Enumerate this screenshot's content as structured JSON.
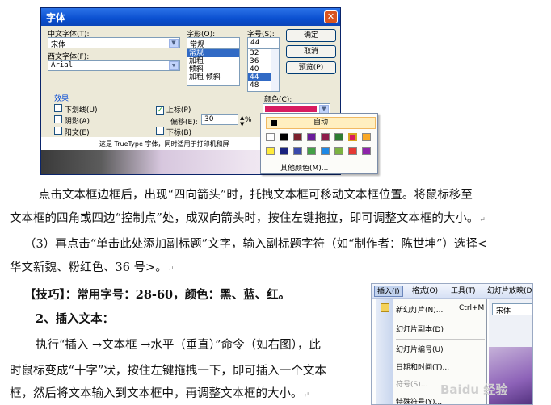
{
  "font_dialog": {
    "title": "字体",
    "close_glyph": "✕",
    "chinese_font_label": "中文字体(T):",
    "chinese_font_value": "宋体",
    "western_font_label": "西文字体(F):",
    "western_font_value": "Arial",
    "style_label": "字形(O):",
    "style_value": "常规",
    "style_options": [
      "常规",
      "加粗",
      "倾斜",
      "加粗 倾斜"
    ],
    "size_label": "字号(S):",
    "size_value": "44",
    "size_options": [
      "32",
      "36",
      "40",
      "44",
      "48"
    ],
    "ok_button": "确定",
    "cancel_button": "取消",
    "preview_button": "预览(P)",
    "effects_label": "效果",
    "underline_label": "下划线(U)",
    "shadow_label": "阴影(A)",
    "emboss_label": "阳文(E)",
    "superscript_label": "上标(P)",
    "offset_label": "偏移(E):",
    "offset_value": "30",
    "percent": "%",
    "subscript_label": "下标(B)",
    "color_label": "颜色(C):",
    "selected_color": "#d81b60",
    "info_text": "这是 TrueType 字体，同时适用于打印机和屏",
    "color_popup": {
      "auto_label": "自动",
      "more_colors_label": "其他颜色(M)...",
      "row1": [
        "#ffffff",
        "#000000",
        "#7b1f2a",
        "#6a1b9a",
        "#8d1b4a",
        "#2e7d32",
        "#d81b60",
        "#f9a825"
      ],
      "row2": [
        "#ffeb3b",
        "#1a237e",
        "#3949ab",
        "#43a047",
        "#1e88e5",
        "#7cb342",
        "#e53935",
        "#8e24aa"
      ],
      "selected_index": 6
    }
  },
  "article": {
    "p1_line1": "点击文本框边框后，出现“四向箭头”时，托拽文本框可移动文本框位置。将鼠标移至",
    "p1_line2": "文本框的四角或四边“控制点”处，成双向箭头时，按住左键拖拉，即可调整文本框的大小。",
    "p2_line1": "（3）再点击“单击此处添加副标题”文字，输入副标题字符（如“制作者：陈世坤”）选择<",
    "p2_line2": "华文新魏、粉红色、36 号>。",
    "tip": "【技巧】：常用字号：28-60，颜色：黑、蓝、红。",
    "section": "2、插入文本：",
    "p3_line1": "执行“插入 →文本框 →水平（垂直）”命令（如右图），此",
    "p3_line2": "时鼠标变成“十字”状，按住左键拖拽一下，即可插入一个文本",
    "p3_line3": "框，然后将文本输入到文本框中，再调整文本框的大小。",
    "return_mark": "↵"
  },
  "insert_menu": {
    "menubar": [
      "插入(I)",
      "格式(O)",
      "工具(T)",
      "幻灯片放映(D)"
    ],
    "items": [
      {
        "label": "新幻灯片(N)...",
        "shortcut": "Ctrl+M"
      },
      {
        "label": "幻灯片副本(D)",
        "shortcut": ""
      },
      {
        "label": "幻灯片编号(U)",
        "shortcut": ""
      },
      {
        "label": "日期和时间(T)...",
        "shortcut": ""
      },
      {
        "label": "符号(S)...",
        "shortcut": ""
      },
      {
        "label": "特殊符号(Y)...",
        "shortcut": ""
      }
    ],
    "font_box": "宋体",
    "watermark": "Baidu 经验"
  }
}
